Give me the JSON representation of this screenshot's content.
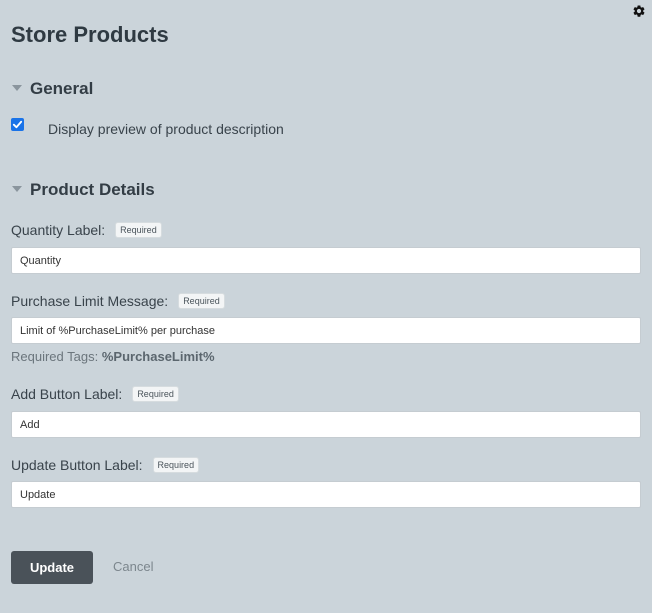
{
  "page": {
    "title": "Store Products"
  },
  "sections": {
    "general": {
      "title": "General",
      "checkbox_label": "Display preview of product description",
      "checkbox_checked": true
    },
    "product_details": {
      "title": "Product Details"
    }
  },
  "fields": {
    "quantity": {
      "label": "Quantity Label:",
      "badge": "Required",
      "value": "Quantity"
    },
    "purchase_limit": {
      "label": "Purchase Limit Message:",
      "badge": "Required",
      "value": "Limit of %PurchaseLimit% per purchase"
    },
    "add_button": {
      "label": "Add Button Label:",
      "badge": "Required",
      "value": "Add"
    },
    "update_button": {
      "label": "Update Button Label:",
      "badge": "Required",
      "value": "Update"
    }
  },
  "required_tags": {
    "prefix": "Required Tags:",
    "tag": "%PurchaseLimit%"
  },
  "actions": {
    "update_label": "Update",
    "cancel_label": "Cancel"
  },
  "icons": {
    "settings": "gear-icon",
    "collapse": "caret-down-icon",
    "check": "checkmark-icon"
  },
  "colors": {
    "background": "#cbd4da",
    "primary_button": "#4a5259",
    "checkbox": "#1a73e8"
  }
}
